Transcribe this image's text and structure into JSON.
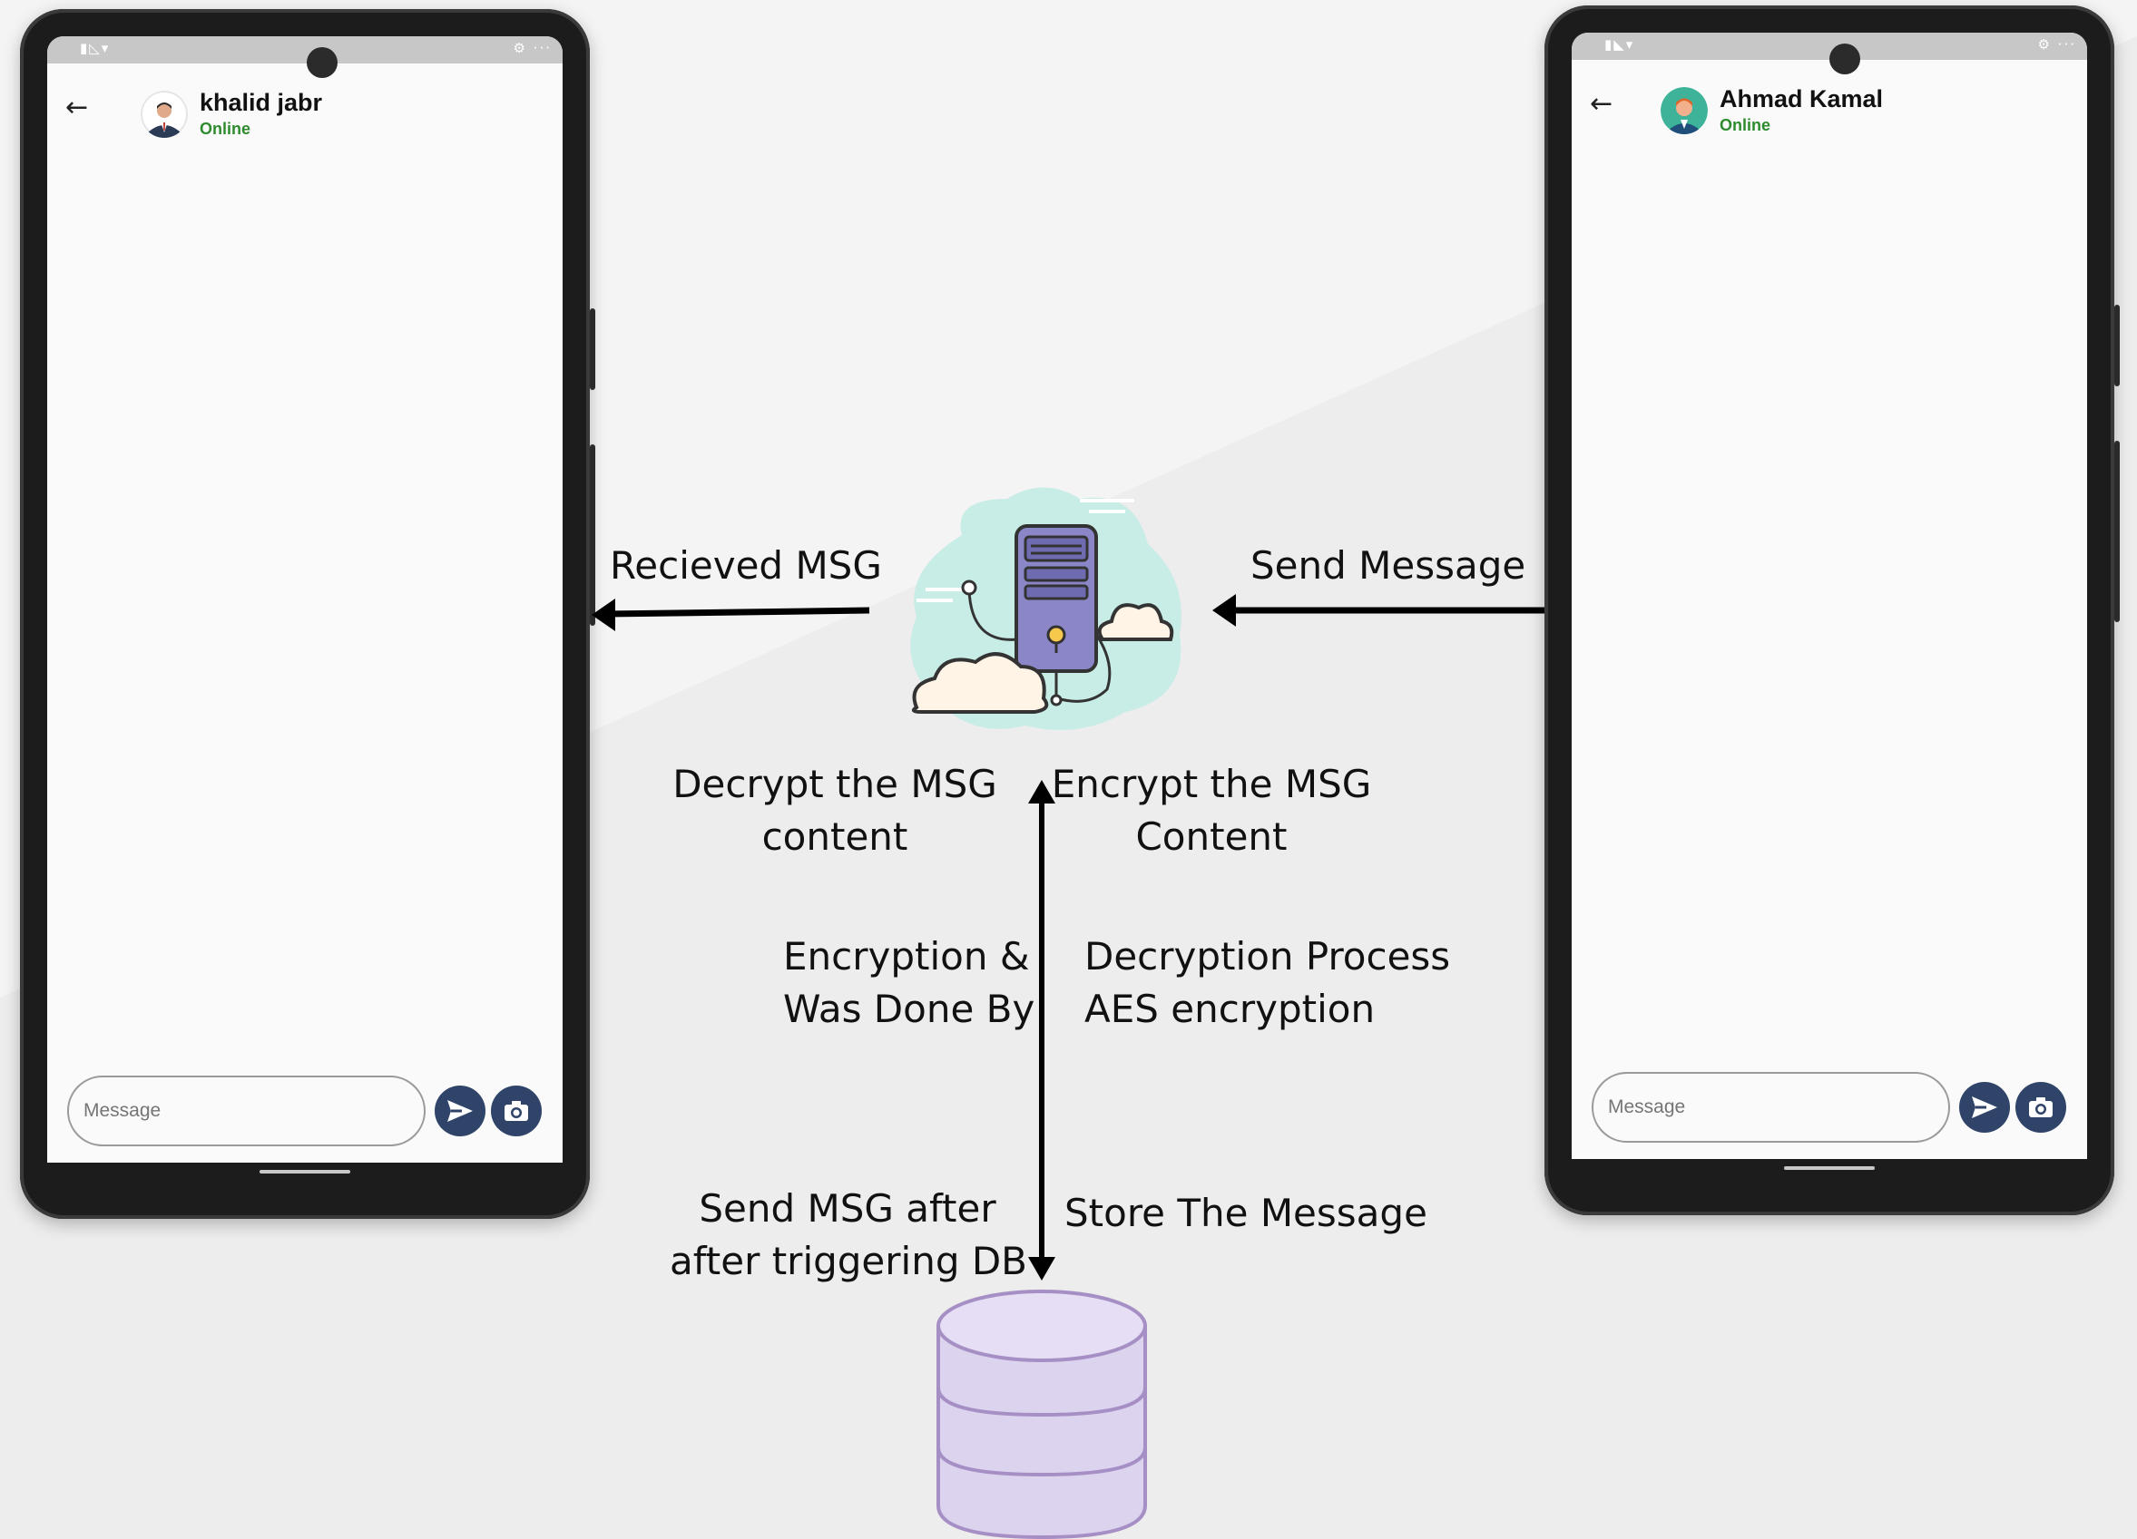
{
  "left_phone": {
    "contact_name": "khalid jabr",
    "contact_status": "Online",
    "input_placeholder": "Message",
    "avatar_icon": "man-in-suit-avatar-icon"
  },
  "right_phone": {
    "contact_name": "Ahmad Kamal",
    "contact_status": "Online",
    "input_placeholder": "Message",
    "avatar_icon": "man-teal-avatar-icon"
  },
  "labels": {
    "received": "Recieved MSG",
    "send": "Send Message",
    "decrypt_line1": "Decrypt the MSG",
    "decrypt_line2": "content",
    "encrypt_line1": "Encrypt the MSG",
    "encrypt_line2": "Content",
    "enc_line1": "Encryption &",
    "enc_line2": "Was Done By",
    "dec_line1": "Decryption Process",
    "dec_line2": "AES encryption",
    "sendafter_line1": "Send MSG after",
    "sendafter_line2": "after triggering DB",
    "store": "Store The Message"
  },
  "colors": {
    "background": "#ededed",
    "online_green": "#2e8b2e",
    "button_navy": "#2f4468",
    "server_purple": "#8a86c8",
    "cloud_mint": "#c8ece6",
    "database_lavender": "#dcd3ef"
  }
}
